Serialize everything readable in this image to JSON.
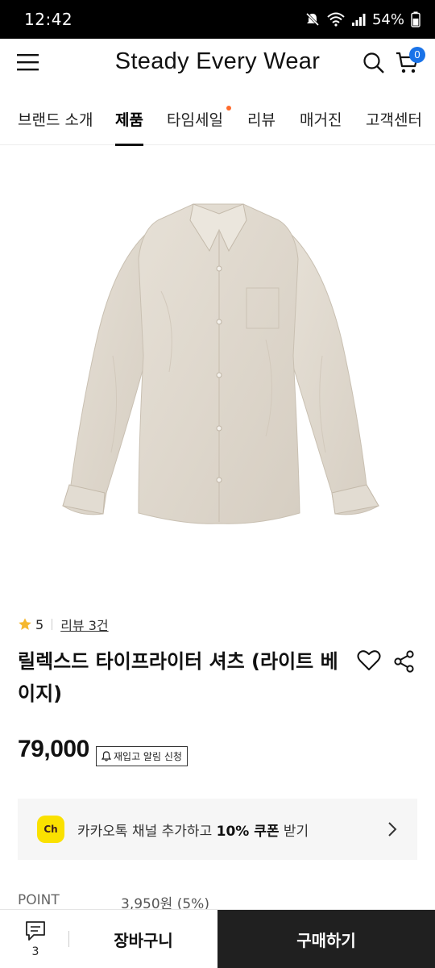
{
  "status_bar": {
    "time": "12:42",
    "battery": "54%"
  },
  "header": {
    "brand": "Steady Every Wear",
    "cart_count": "0"
  },
  "nav": {
    "items": [
      {
        "label": "브랜드 소개"
      },
      {
        "label": "제품",
        "active": true
      },
      {
        "label": "타임세일",
        "has_new_dot": true
      },
      {
        "label": "리뷰"
      },
      {
        "label": "매거진"
      },
      {
        "label": "고객센터"
      }
    ]
  },
  "product": {
    "rating": "5",
    "review_link": "리뷰 3건",
    "title": "릴렉스드 타이프라이터 셔츠 (라이트 베이지)",
    "price": "79,000",
    "restock_label": "재입고 알림 신청",
    "image_color": "#e3ddd3"
  },
  "kakao": {
    "logo_text": "Ch",
    "text_before": "카카오톡 채널 추가하고 ",
    "text_bold": "10% 쿠폰",
    "text_after": " 받기"
  },
  "point": {
    "label": "POINT",
    "value": "3,950원 (5%)"
  },
  "bottom_bar": {
    "chat_count": "3",
    "cart_label": "장바구니",
    "buy_label": "구매하기"
  },
  "colors": {
    "accent_badge": "#1a73e8",
    "new_dot": "#ff6b2c",
    "kakao_yellow": "#fae100",
    "buy_button": "#202020"
  }
}
